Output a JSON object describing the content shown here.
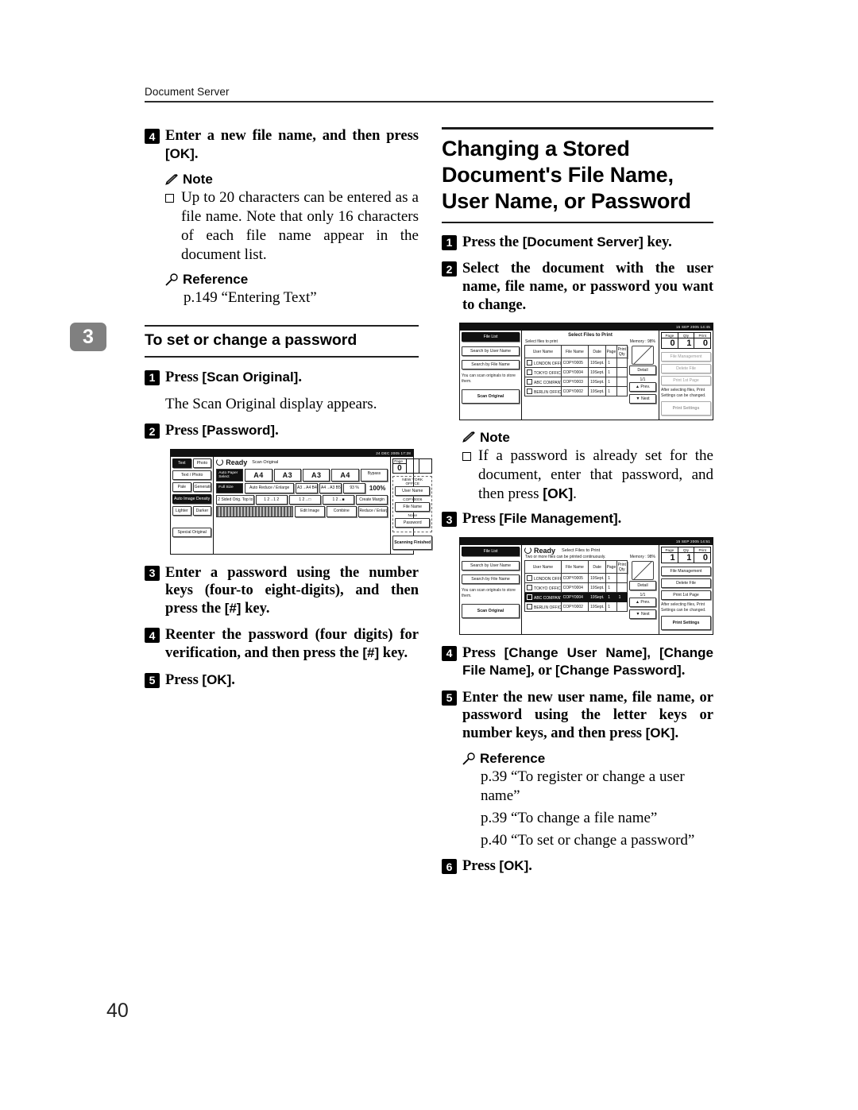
{
  "header": {
    "running_head": "Document Server"
  },
  "chapter_tab": "3",
  "page_number": "40",
  "left_column": {
    "step4": {
      "num": "4",
      "text_a": "Enter a new file name, and then press ",
      "text_ui": "[OK]",
      "text_b": "."
    },
    "note1": {
      "title": "Note",
      "bullet": "Up to 20 characters can be entered as a file name. Note that only 16 characters of each file name appear in the document list."
    },
    "reference1": {
      "title": "Reference",
      "lines": [
        "p.149 “Entering Text”"
      ]
    },
    "section_heading": "To set or change a password",
    "step1": {
      "num": "1",
      "text_a": "Press ",
      "text_ui": "[Scan Original]",
      "text_b": "."
    },
    "step1_body": "The Scan Original display appears.",
    "step2": {
      "num": "2",
      "text_a": "Press ",
      "text_ui": "[Password]",
      "text_b": "."
    },
    "step3": {
      "num": "3",
      "text_a": "Enter a password using the number keys (four-to eight-digits), and then press the ",
      "text_ui": "[#]",
      "text_b": " key."
    },
    "step4b": {
      "num": "4",
      "text_a": "Reenter the password (four digits) for verification, and then press the ",
      "text_ui": "[#]",
      "text_b": " key."
    },
    "step5": {
      "num": "5",
      "text_a": "Press ",
      "text_ui": "[OK]",
      "text_b": "."
    }
  },
  "right_column": {
    "big_heading": "Changing a Stored Document's File Name, User Name, or Password",
    "step1": {
      "num": "1",
      "text_a": "Press the ",
      "text_ui": "[Document Server]",
      "text_b": " key."
    },
    "step2": {
      "num": "2",
      "text_a": "Select the document with the user name, file name, or password you want to change.",
      "text_ui": "",
      "text_b": ""
    },
    "note2": {
      "title": "Note",
      "bullet_a": "If a password is already set for the document, enter that password, and then press ",
      "bullet_ui": "[OK]",
      "bullet_b": "."
    },
    "step3": {
      "num": "3",
      "text_a": "Press ",
      "text_ui": "[File Management]",
      "text_b": "."
    },
    "step4": {
      "num": "4",
      "text_a": "Press ",
      "text_ui": "[Change User Name], [Change File Name]",
      "text_mid": ", or ",
      "text_ui2": "[Change Password]",
      "text_b": "."
    },
    "step5": {
      "num": "5",
      "text_a": "Enter the new user name, file name, or password using the letter keys or number keys, and then press ",
      "text_ui": "[OK]",
      "text_b": "."
    },
    "reference2": {
      "title": "Reference",
      "lines": [
        "p.39 “To register or change a user name”",
        "p.39 “To change a file name”",
        "p.40 “To set or change a password”"
      ]
    },
    "step6": {
      "num": "6",
      "text_a": "Press ",
      "text_ui": "[OK]",
      "text_b": "."
    }
  },
  "lcd_scan_original": {
    "timestamp": "24 DEC 2005 17:28",
    "status": "Ready",
    "title": "Scan Original",
    "left_keys": [
      [
        "Text",
        "Photo"
      ],
      [
        "Text / Photo"
      ],
      [
        "Pale",
        "Generation"
      ],
      [
        "Auto Image Density"
      ],
      [
        "Lighter",
        "Darker"
      ],
      [
        "Special Original"
      ]
    ],
    "paper_label": "Auto Paper Select",
    "paper_sizes": [
      "A4",
      "A3",
      "A3",
      "A4"
    ],
    "bypass_label": "Bypass",
    "zoom_row_label": "Full Size",
    "zoom_keys": [
      "Auto Reduce / Enlarge",
      "A3→A4 B4→B5",
      "A4→A3 B5→B4",
      "93 %"
    ],
    "zoom_value": "100%",
    "dup_label": "2 Sided Orig. Top to Top",
    "create_margin": "Create Margin",
    "bottom_keys": [
      "Edit Image",
      "Combine",
      "Reduce / Enlarge"
    ],
    "page_label": "Page",
    "page_value": "0",
    "right_user": "NEW YORK OFFICE",
    "right_user_key": "User Name",
    "right_file": "COPY0006",
    "right_file_key": "File Name",
    "right_pw": "None",
    "right_pw_key": "Password",
    "right_finish": "Scanning Finished"
  },
  "lcd_select_files_1": {
    "timestamp": "15 SEP 2005 14:45",
    "status": "",
    "title": "Select Files to Print",
    "subtitle": "Select files to print",
    "memory": "Memory :  98%",
    "left_keys": [
      "File List",
      "Search by User Name",
      "Search by File Name"
    ],
    "left_note": "You can scan originals to store them.",
    "left_action": "Scan Original",
    "columns": [
      "User Name",
      "File Name",
      "Date",
      "Page",
      "Print Qty"
    ],
    "rows": [
      {
        "user": "LONDON OFFICE",
        "file": "COPY0005",
        "date": "19Sept.",
        "page": "1",
        "qty": "",
        "selected": false
      },
      {
        "user": "TOKYO OFFICE",
        "file": "COPY0004",
        "date": "19Sept.",
        "page": "1",
        "qty": "",
        "selected": false
      },
      {
        "user": "ABC COMPANY",
        "file": "COPY0003",
        "date": "19Sept.",
        "page": "1",
        "qty": "",
        "selected": false
      },
      {
        "user": "BERLIN OFFICE",
        "file": "COPY0002",
        "date": "19Sept.",
        "page": "1",
        "qty": "",
        "selected": false
      }
    ],
    "detail_key": "Detail",
    "paging": "1/1",
    "prev_key": "Prev.",
    "next_key": "Next",
    "counter": [
      {
        "label": "Page",
        "value": "0"
      },
      {
        "label": "Qty",
        "value": "1"
      },
      {
        "label": "Print",
        "value": "0"
      }
    ],
    "right_keys": [
      "File Management",
      "Delete File",
      "Print 1st Page"
    ],
    "right_note": "After selecting files, Print Settings can be changed.",
    "right_action": "Print Settings",
    "right_dimmed": true
  },
  "lcd_select_files_2": {
    "timestamp": "15 SEP 2005 14:51",
    "status": "Ready",
    "title": "Select Files to Print",
    "subtitle": "Two or more files can be printed continuously.",
    "memory": "Memory :  98%",
    "left_keys": [
      "File List",
      "Search by User Name",
      "Search by File Name"
    ],
    "left_note": "You can scan originals to store them.",
    "left_action": "Scan Original",
    "columns": [
      "User Name",
      "File Name",
      "Date",
      "Page",
      "Print Qty"
    ],
    "rows": [
      {
        "user": "LONDON OFFICE",
        "file": "COPY0005",
        "date": "19Sept.",
        "page": "1",
        "qty": "",
        "selected": false
      },
      {
        "user": "TOKYO OFFICE",
        "file": "COPY0004",
        "date": "19Sept.",
        "page": "1",
        "qty": "",
        "selected": false
      },
      {
        "user": "ABC COMPANY",
        "file": "COPY0004",
        "date": "19Sept.",
        "page": "1",
        "qty": "1",
        "selected": true
      },
      {
        "user": "BERLIN OFFICE",
        "file": "COPY0002",
        "date": "19Sept.",
        "page": "1",
        "qty": "",
        "selected": false
      }
    ],
    "detail_key": "Detail",
    "paging": "1/1",
    "prev_key": "Prev.",
    "next_key": "Next",
    "counter": [
      {
        "label": "Page",
        "value": "1"
      },
      {
        "label": "Qty",
        "value": "1"
      },
      {
        "label": "Print",
        "value": "0"
      }
    ],
    "right_keys": [
      "File Management",
      "Delete File",
      "Print 1st Page"
    ],
    "right_note": "After selecting files, Print Settings can be changed.",
    "right_action": "Print Settings",
    "right_dimmed": false
  }
}
